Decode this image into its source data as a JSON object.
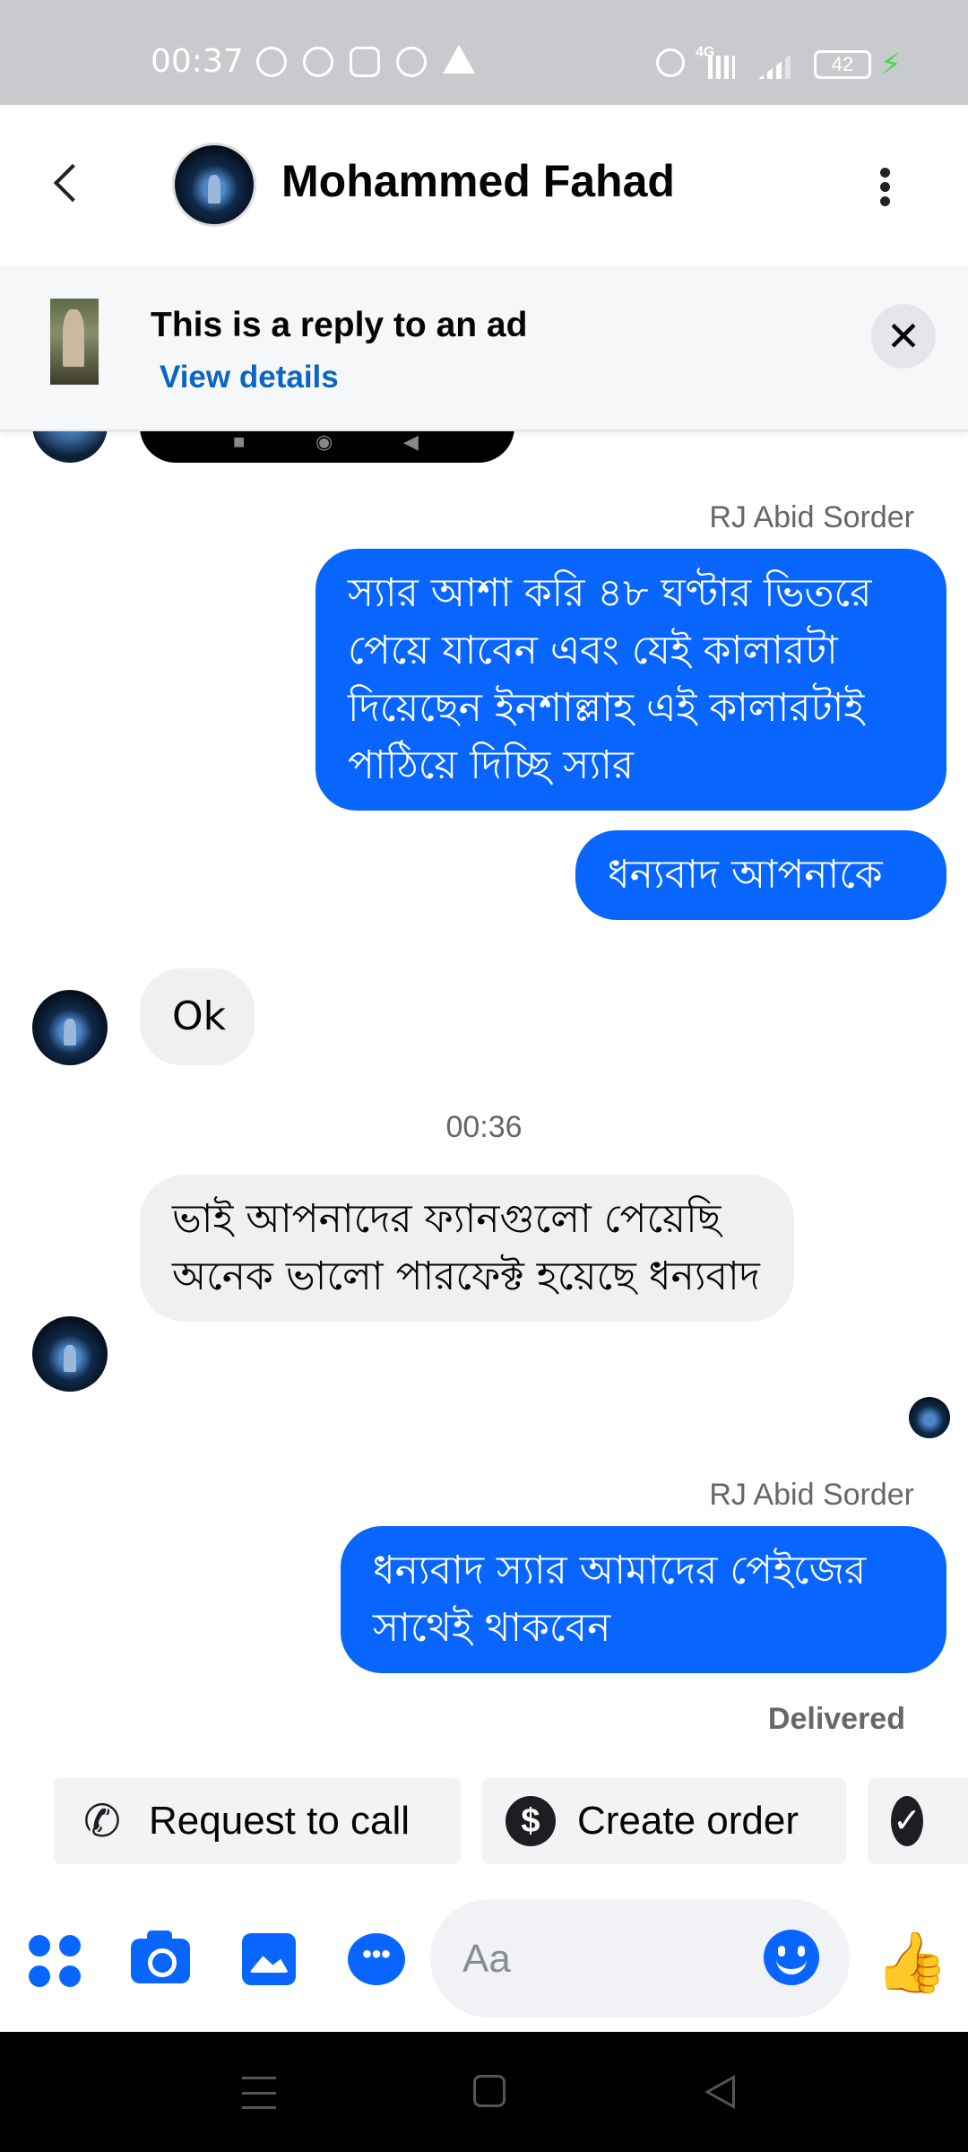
{
  "status_bar": {
    "time": "00:37",
    "battery": "42"
  },
  "header": {
    "contact_name": "Mohammed Fahad"
  },
  "ad_banner": {
    "title": "This is a reply to an ad",
    "link": "View details",
    "close_glyph": "✕"
  },
  "messages": [
    {
      "sender": "RJ Abid Sorder",
      "text": "স্যার আশা করি ৪৮ ঘণ্টার ভিতরে পেয়ে যাবেন এবং যেই কালারটা দিয়েছেন ইনশাল্লাহ এই কালারটাই পাঠিয়ে দিচ্ছি স্যার"
    },
    {
      "text": "ধন্যবাদ আপনাকে"
    },
    {
      "text": "Ok"
    },
    {
      "timestamp": "00:36"
    },
    {
      "text": "ভাই আপনাদের ফ্যানগুলো পেয়েছি অনেক ভালো পারফেক্ট হয়েছে ধন্যবাদ"
    },
    {
      "sender": "RJ Abid Sorder",
      "text": "ধন্যবাদ স্যার আমাদের পেইজের সাথেই থাকবেন",
      "status": "Delivered"
    }
  ],
  "quick_actions": [
    {
      "label": "Request to call",
      "icon": "phone-plus-icon"
    },
    {
      "label": "Create order",
      "icon": "dollar-icon"
    },
    {
      "label": "",
      "icon": "checkmark-icon"
    }
  ],
  "composer": {
    "placeholder": "Aa"
  },
  "colors": {
    "accent": "#0866ff",
    "incoming_bubble": "#f0f0f2",
    "status_bar": "#c9cacd"
  }
}
